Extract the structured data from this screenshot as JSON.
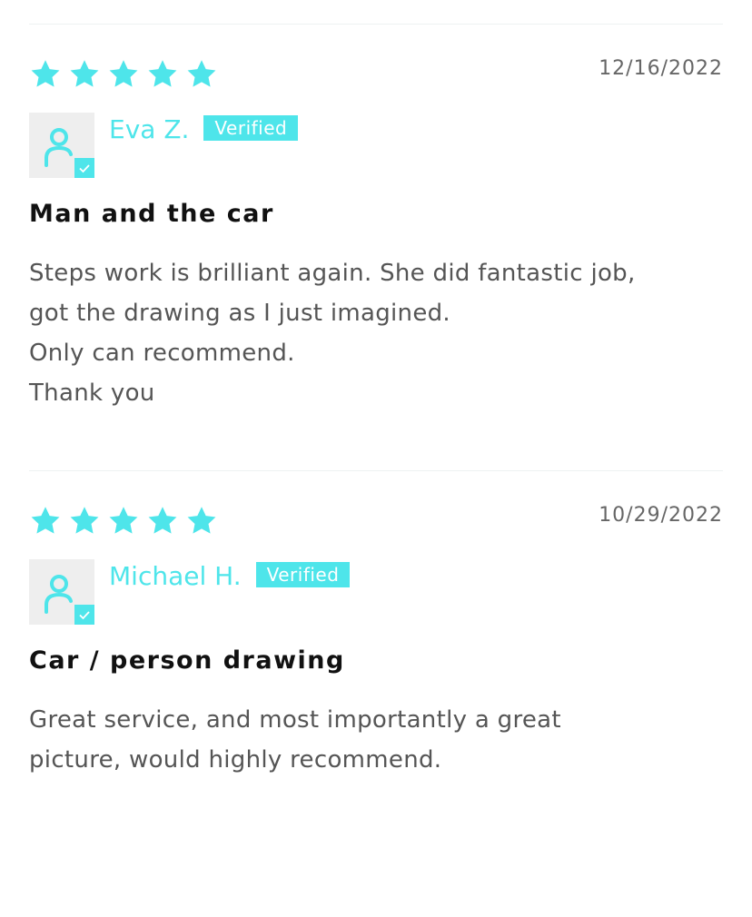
{
  "colors": {
    "accent": "#4ee5ea",
    "divider": "#edf2f2",
    "avatar_bg": "#eeeeee",
    "title": "#111111",
    "body": "#555555",
    "date": "#666666"
  },
  "reviews": [
    {
      "rating": 5,
      "date": "12/16/2022",
      "author": "Eva Z.",
      "badge": "Verified",
      "title": "Man and the car",
      "body_lines": [
        "Steps work is brilliant again. She did fantastic job,",
        "got the drawing as I just imagined.",
        "Only can recommend.",
        "Thank you"
      ]
    },
    {
      "rating": 5,
      "date": "10/29/2022",
      "author": "Michael H.",
      "badge": "Verified",
      "title": "Car / person drawing",
      "body_lines": [
        "Great service, and most importantly a great",
        "picture, would highly recommend."
      ]
    }
  ]
}
